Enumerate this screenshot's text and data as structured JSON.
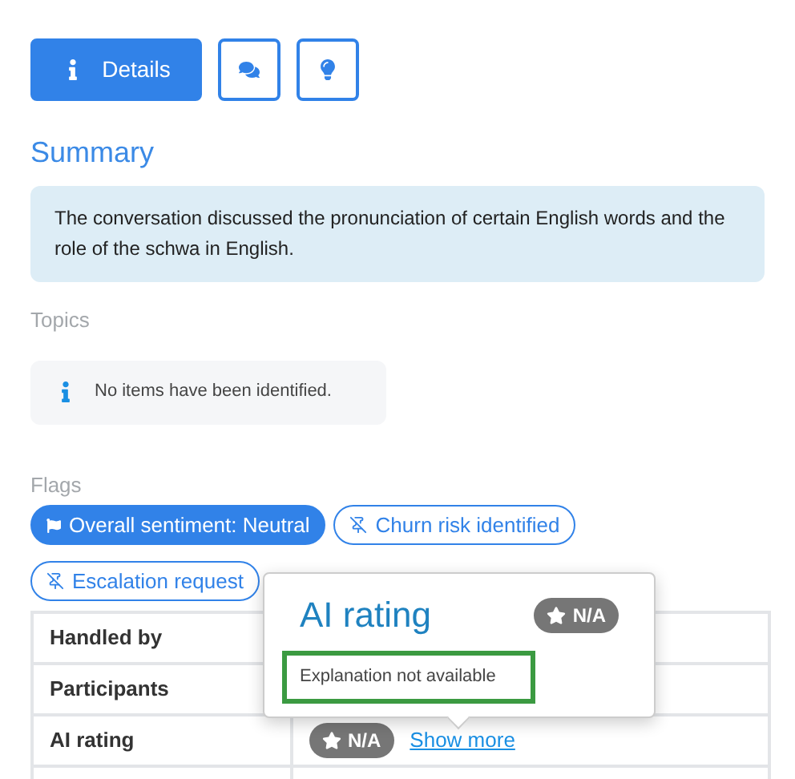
{
  "tabs": [
    {
      "kind": "details",
      "label": "Details",
      "selected": true
    },
    {
      "kind": "chat",
      "selected": false
    },
    {
      "kind": "insights",
      "selected": false
    }
  ],
  "summary": {
    "heading": "Summary",
    "text": "The conversation discussed the pronunciation of certain English words and the role of the schwa in English."
  },
  "topics": {
    "heading": "Topics",
    "empty_message": "No items have been identified."
  },
  "flags": {
    "heading": "Flags",
    "items": [
      {
        "label": "Overall sentiment: Neutral",
        "selected": true
      },
      {
        "label": "Churn risk identified",
        "selected": false
      },
      {
        "label": "Escalation request",
        "selected": false
      }
    ]
  },
  "table": {
    "rows": [
      {
        "label": "Handled by"
      },
      {
        "label": "Participants"
      },
      {
        "label": "AI rating",
        "rating": "N/A",
        "link": "Show more"
      }
    ]
  },
  "popover": {
    "title": "AI rating",
    "rating": "N/A",
    "explanation": "Explanation not available"
  }
}
